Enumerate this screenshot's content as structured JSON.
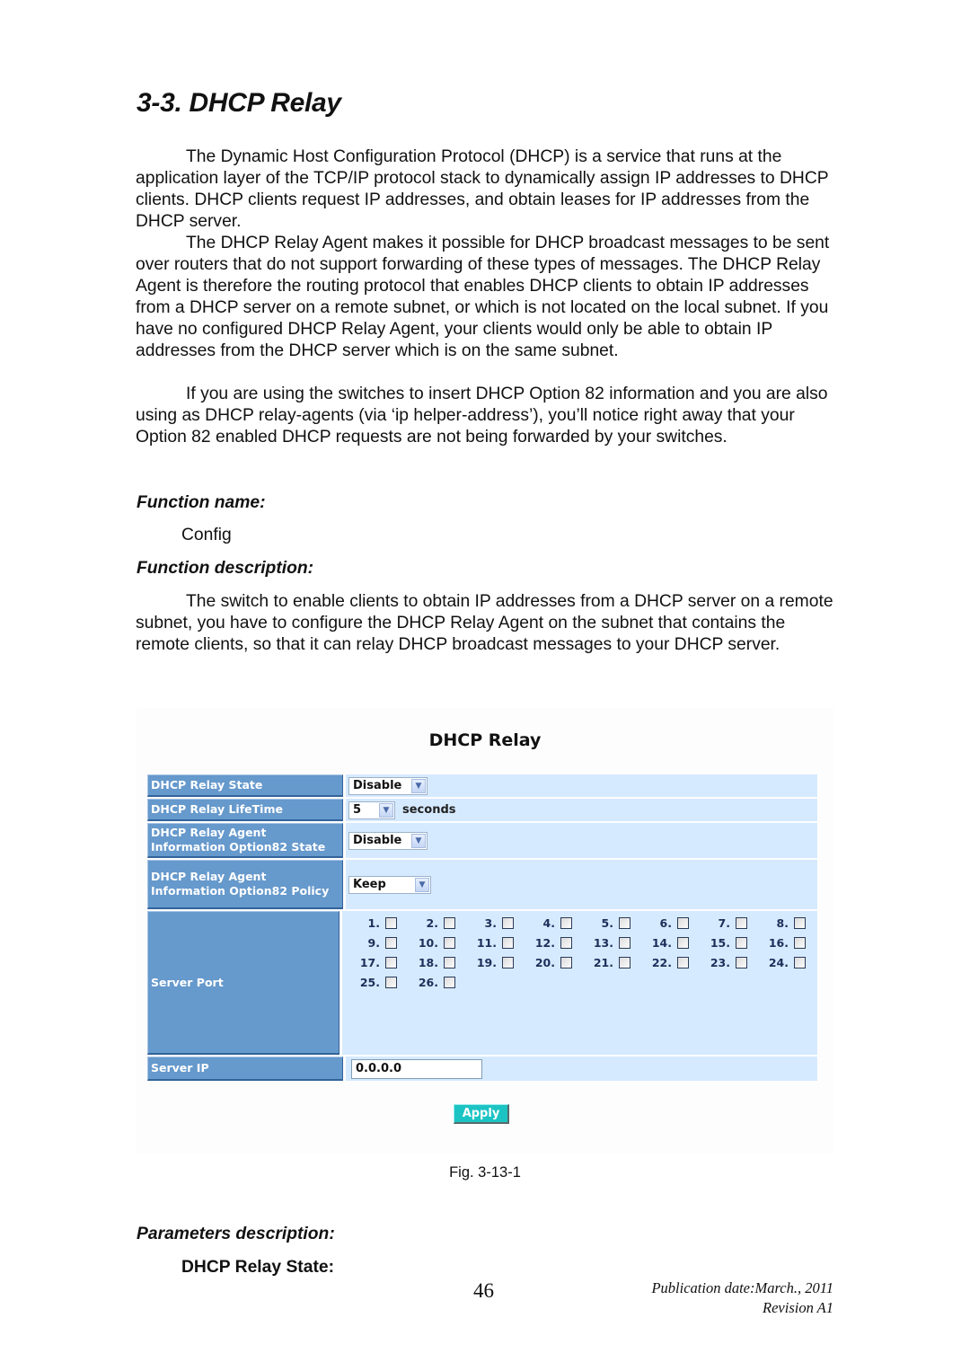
{
  "document": {
    "title": "3-3. DHCP Relay",
    "intro_paragraphs": [
      "The Dynamic Host Configuration Protocol (DHCP) is a service that runs at the application layer of the TCP/IP protocol stack to dynamically assign IP addresses to DHCP clients. DHCP clients request IP addresses, and obtain leases for IP addresses from the DHCP server.",
      "The DHCP Relay Agent makes it possible for DHCP broadcast messages to be sent over routers that do not support forwarding of these types of messages. The DHCP Relay Agent is therefore the routing protocol that enables DHCP clients to obtain IP addresses from a DHCP server on a remote subnet, or which is not located on the local subnet. If you have no configured DHCP Relay Agent, your clients would only be able to obtain IP addresses from the DHCP server which is on the same subnet.",
      "If you are using the switches to insert DHCP Option 82 information and you are also using as DHCP relay-agents (via ‘ip helper-address’), you’ll notice right away that your Option 82 enabled DHCP requests are not being forwarded by your switches."
    ],
    "function_name_heading": "Function name:",
    "function_name_value": "Config",
    "function_description_heading": "Function description:",
    "function_description": "The switch to enable clients to obtain IP addresses from a DHCP server on a remote subnet, you have to configure the DHCP Relay Agent on the subnet that contains the remote clients, so that it can relay DHCP broadcast messages to your DHCP server.",
    "figure_caption": "Fig. 3-13-1",
    "parameters_heading": "Parameters description:",
    "first_parameter": "DHCP Relay State:",
    "page_number": "46",
    "publication_date": "Publication date:March., 2011",
    "revision": "Revision A1"
  },
  "ui": {
    "title": "DHCP Relay",
    "relay_state": {
      "label": "DHCP Relay State",
      "value": "Disable"
    },
    "relay_lifetime": {
      "label": "DHCP Relay LifeTime",
      "value": "5",
      "unit": "seconds"
    },
    "option82_state": {
      "label": "DHCP Relay Agent Information Option82 State",
      "value": "Disable"
    },
    "option82_policy": {
      "label": "DHCP Relay Agent Information Option82 Policy",
      "value": "Keep"
    },
    "server_port": {
      "label": "Server Port",
      "ports": [
        {
          "label": "1.",
          "checked": false
        },
        {
          "label": "2.",
          "checked": false
        },
        {
          "label": "3.",
          "checked": false
        },
        {
          "label": "4.",
          "checked": false
        },
        {
          "label": "5.",
          "checked": false
        },
        {
          "label": "6.",
          "checked": false
        },
        {
          "label": "7.",
          "checked": false
        },
        {
          "label": "8.",
          "checked": false
        },
        {
          "label": "9.",
          "checked": false
        },
        {
          "label": "10.",
          "checked": false
        },
        {
          "label": "11.",
          "checked": false
        },
        {
          "label": "12.",
          "checked": false
        },
        {
          "label": "13.",
          "checked": false
        },
        {
          "label": "14.",
          "checked": false
        },
        {
          "label": "15.",
          "checked": false
        },
        {
          "label": "16.",
          "checked": false
        },
        {
          "label": "17.",
          "checked": false
        },
        {
          "label": "18.",
          "checked": false
        },
        {
          "label": "19.",
          "checked": false
        },
        {
          "label": "20.",
          "checked": false
        },
        {
          "label": "21.",
          "checked": false
        },
        {
          "label": "22.",
          "checked": false
        },
        {
          "label": "23.",
          "checked": false
        },
        {
          "label": "24.",
          "checked": false
        },
        {
          "label": "25.",
          "checked": false
        },
        {
          "label": "26.",
          "checked": false
        }
      ]
    },
    "server_ip": {
      "label": "Server IP",
      "value": "0.0.0.0"
    },
    "apply_label": "Apply",
    "colors": {
      "label_bg": "#6699cc",
      "value_bg": "#d6eaff",
      "apply_bg": "#1cc3c3",
      "port_label": "#1c2f5a"
    }
  }
}
